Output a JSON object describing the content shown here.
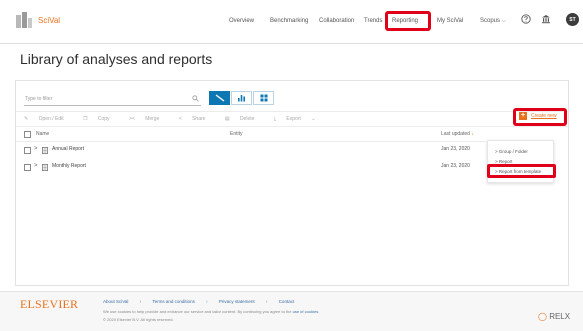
{
  "app": {
    "name": "SciVal"
  },
  "nav": {
    "items": [
      {
        "label": "Overview",
        "caret": false
      },
      {
        "label": "Benchmarking",
        "caret": false
      },
      {
        "label": "Collaboration",
        "caret": false
      },
      {
        "label": "Trends",
        "caret": false
      },
      {
        "label": "Reporting",
        "caret": false,
        "active": true
      },
      {
        "label": "My SciVal",
        "caret": false
      },
      {
        "label": "Scopus",
        "caret": true
      }
    ],
    "icons": [
      "help-icon",
      "institution-icon"
    ],
    "avatar_initials": "ST"
  },
  "page": {
    "title": "Library of analyses and reports"
  },
  "toolbar": {
    "filter_placeholder": "Type to filter",
    "view_buttons": [
      "list-view-icon",
      "chart-view-icon",
      "grid-view-icon"
    ],
    "actions": [
      "Open / Edit",
      "Copy",
      "Merge",
      "Share",
      "Delete",
      "Export"
    ],
    "create_new_label": "Create new"
  },
  "table": {
    "headers": {
      "name": "Name",
      "entity": "Entity",
      "last_updated": "Last updated"
    },
    "rows": [
      {
        "name": "Annual Report",
        "entity": "",
        "last_updated": "Jan 23, 2020"
      },
      {
        "name": "Monthly Report",
        "entity": "",
        "last_updated": "Jan 23, 2020"
      }
    ]
  },
  "dropdown": {
    "items": [
      "Group / Folder",
      "Report",
      "Report from template"
    ]
  },
  "footer": {
    "logo": "ELSEVIER",
    "links": [
      "About SciVal",
      "Terms and conditions",
      "Privacy statement",
      "Contact"
    ],
    "cookie_text": "We use cookies to help provide and enhance our service and tailor content. By continuing you agree to the",
    "cookie_link": "use of cookies",
    "copyright": "© 2020 Elsevier B.V. All rights reserved.",
    "relx": "RELX"
  },
  "colors": {
    "accent": "#e9711c",
    "primary": "#0d77b3",
    "highlight": "#e0001a"
  }
}
